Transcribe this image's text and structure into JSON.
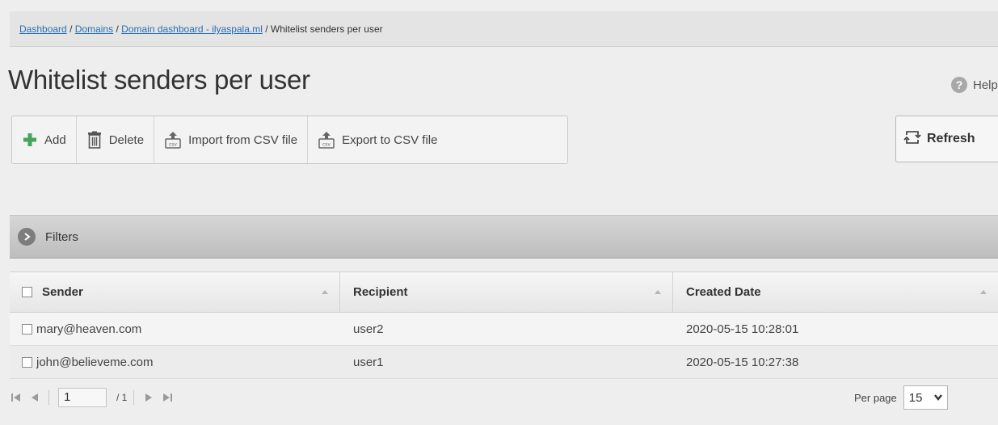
{
  "breadcrumb": {
    "items": [
      "Dashboard",
      "Domains",
      "Domain dashboard - ilyaspala.ml"
    ],
    "current": "Whitelist senders per user",
    "separator": "/"
  },
  "page": {
    "title": "Whitelist senders per user"
  },
  "help": {
    "label": "Help",
    "icon_glyph": "?"
  },
  "toolbar": {
    "add_label": "Add",
    "delete_label": "Delete",
    "import_label": "Import from CSV file",
    "export_label": "Export to CSV file",
    "csv_badge": "csv"
  },
  "refresh_label": "Refresh",
  "filters": {
    "label": "Filters"
  },
  "grid": {
    "headers": [
      "Sender",
      "Recipient",
      "Created Date"
    ],
    "rows": [
      {
        "sender": "mary@heaven.com",
        "recipient": "user2",
        "created": "2020-05-15 10:28:01"
      },
      {
        "sender": "john@believeme.com",
        "recipient": "user1",
        "created": "2020-05-15 10:27:38"
      }
    ]
  },
  "pager": {
    "page_value": "1",
    "total": "/ 1",
    "per_page_label": "Per page",
    "per_page_value": "15"
  },
  "colors": {
    "link": "#2a6eb5",
    "add_icon": "#47a35b",
    "background": "#eeeeee"
  }
}
